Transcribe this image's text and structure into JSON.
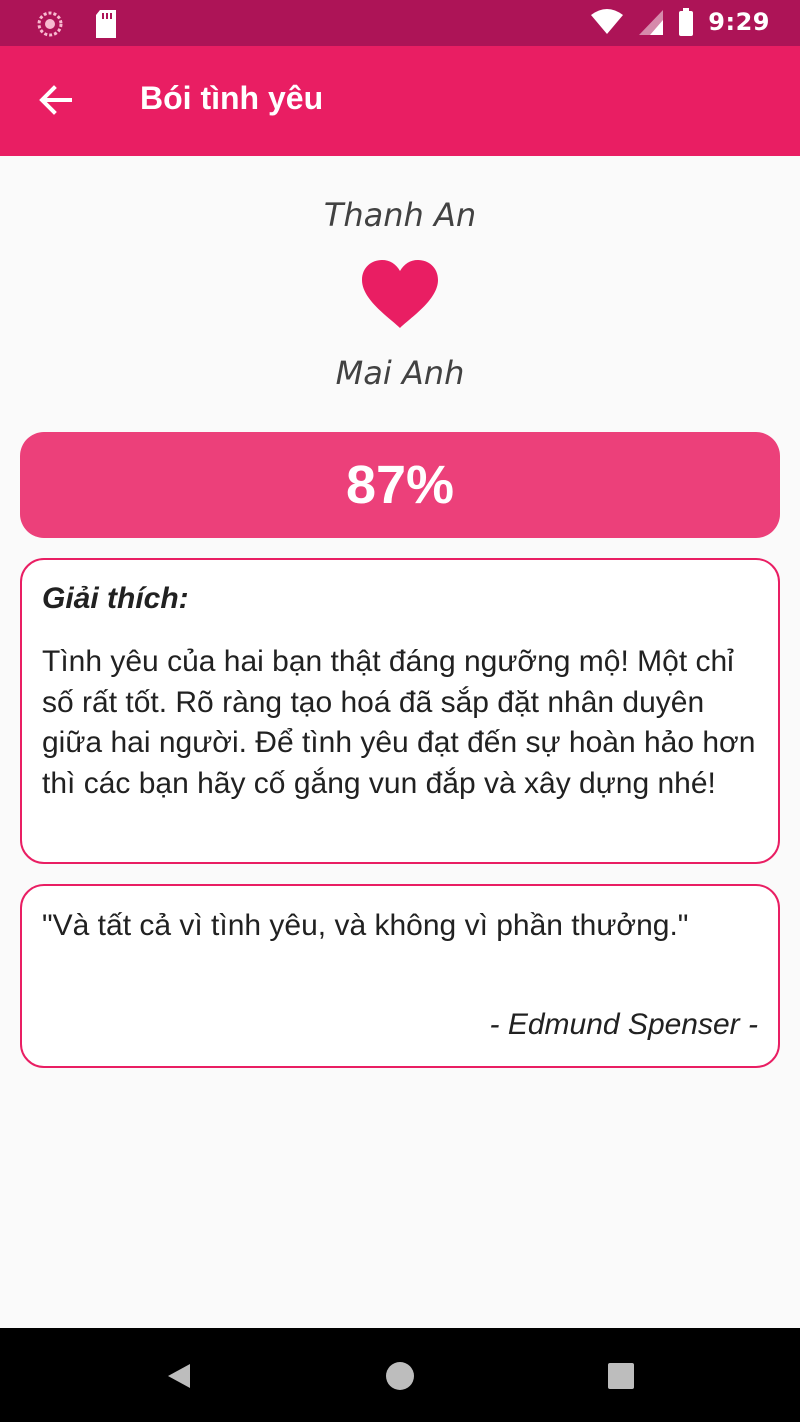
{
  "status_bar": {
    "time": "9:29",
    "icons": [
      "sync-icon",
      "sd-card-icon",
      "wifi-icon",
      "signal-icon",
      "battery-icon"
    ]
  },
  "app_bar": {
    "title": "Bói tình yêu",
    "back_icon": "arrow-back-icon"
  },
  "result": {
    "name_one": "Thanh An",
    "name_two": "Mai Anh",
    "heart_icon": "heart-icon",
    "percent": "87%"
  },
  "explanation": {
    "heading": "Giải thích:",
    "text": "Tình yêu của hai bạn thật đáng ngưỡng mộ! Một chỉ số rất tốt. Rõ ràng tạo hoá đã sắp đặt nhân duyên giữa hai người. Để tình yêu đạt đến sự hoàn hảo hơn thì các bạn hãy cố gắng vun đắp và xây dựng nhé!"
  },
  "quote": {
    "text": "\"Và tất cả vì tình yêu, và không vì phần thưởng.\"",
    "author": "- Edmund Spenser -"
  },
  "colors": {
    "status_bar": "#ad1457",
    "primary": "#e91e63",
    "percent_box": "#ec407a",
    "background": "#fafafa"
  },
  "nav_bar": {
    "icons": [
      "nav-back-icon",
      "nav-home-icon",
      "nav-recents-icon"
    ]
  }
}
